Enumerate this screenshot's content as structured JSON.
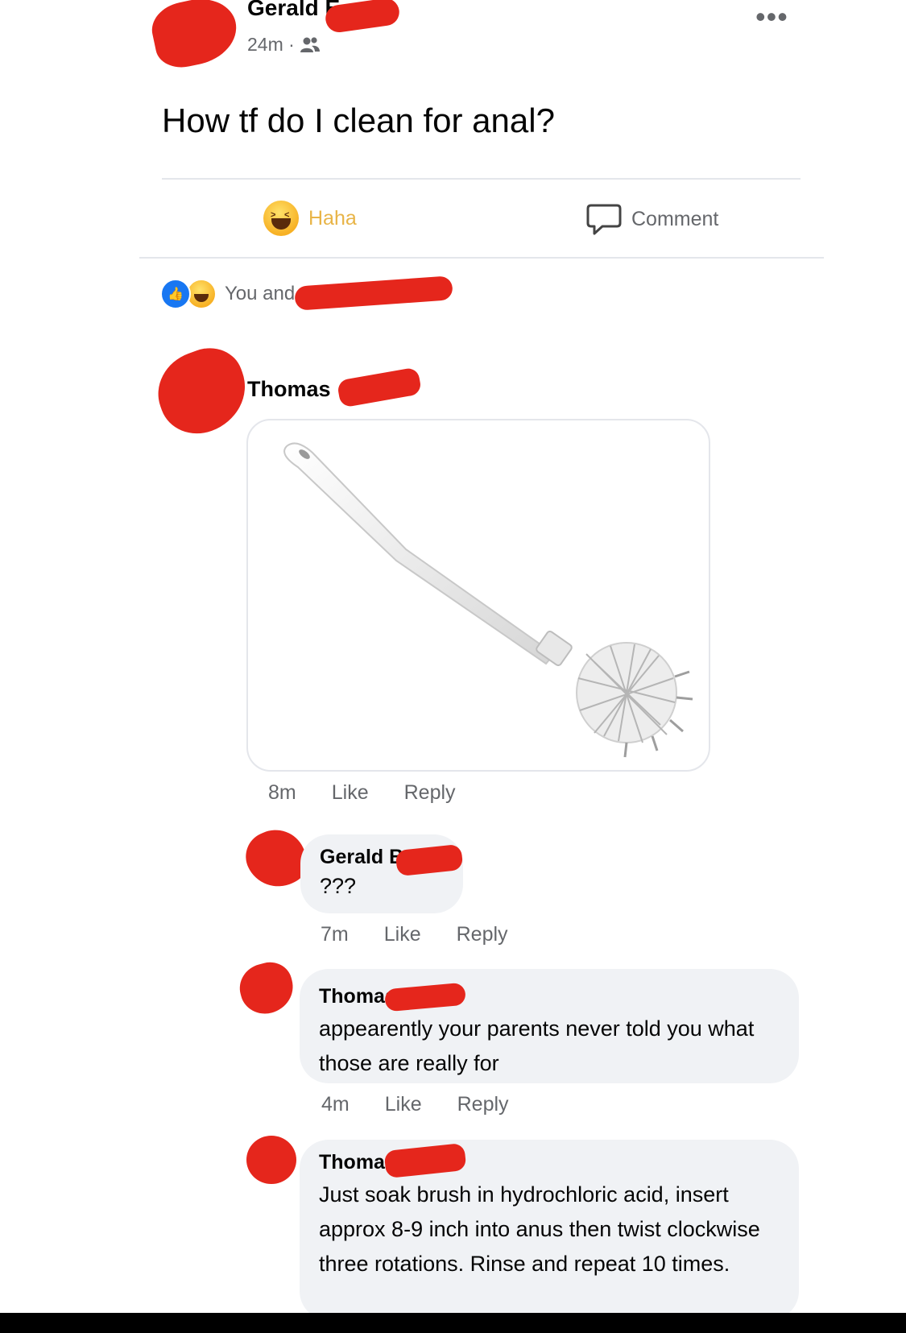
{
  "post": {
    "author": "Gerald E",
    "time": "24m ·",
    "text": "How tf do I clean for anal?",
    "more_label": "•••"
  },
  "actions": {
    "haha_label": "Haha",
    "comment_label": "Comment"
  },
  "reactions": {
    "summary": "You and"
  },
  "comments": [
    {
      "author": "Thomas",
      "attachment": "toilet-brush-image",
      "time": "8m",
      "like_label": "Like",
      "reply_label": "Reply"
    },
    {
      "author": "Gerald B",
      "text": "???",
      "time": "7m",
      "like_label": "Like",
      "reply_label": "Reply"
    },
    {
      "author": "Thomas",
      "text": "appearently your parents never told you what those are really for",
      "time": "4m",
      "like_label": "Like",
      "reply_label": "Reply"
    },
    {
      "author": "Thomas",
      "text": "Just soak brush in hydrochloric acid, insert approx 8-9 inch into anus then twist clockwise three rotations. Rinse and repeat 10 times."
    }
  ],
  "colors": {
    "redaction": "#e5261c",
    "like_blue": "#1877f2",
    "haha_yellow": "#f7b125",
    "bubble_gray": "#f0f2f5",
    "muted_text": "#65676b"
  }
}
